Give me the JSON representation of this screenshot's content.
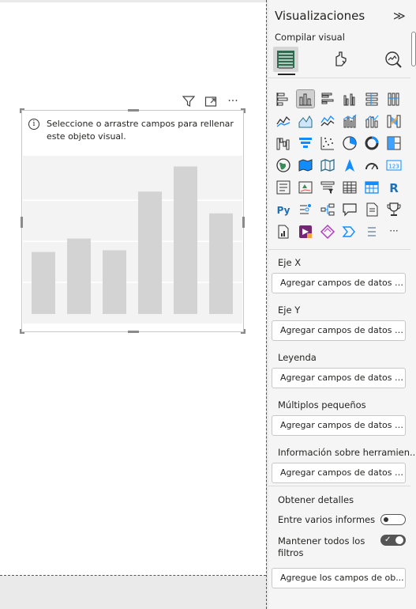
{
  "visual": {
    "message": "Seleccione o arrastre campos para rellenar este objeto visual.",
    "header_icons": [
      "filter-icon",
      "focus-mode-icon",
      "more-options-icon"
    ],
    "more_glyph": "···",
    "placeholder_bars": [
      0.37,
      0.45,
      0.38,
      0.73,
      0.88,
      0.6
    ]
  },
  "pane": {
    "title": "Visualizaciones",
    "collapse_glyph": "≫",
    "subtitle": "Compilar visual",
    "tabs": [
      "build-visual-icon",
      "format-visual-icon",
      "analytics-icon"
    ],
    "visual_types": [
      "stacked-bar-chart-icon",
      "stacked-column-chart-icon",
      "clustered-bar-chart-icon",
      "clustered-column-chart-icon",
      "100-stacked-bar-chart-icon",
      "100-stacked-column-chart-icon",
      "line-chart-icon",
      "area-chart-icon",
      "stacked-area-chart-icon",
      "line-clustered-column-icon",
      "line-stacked-column-icon",
      "ribbon-chart-icon",
      "waterfall-chart-icon",
      "funnel-icon",
      "scatter-chart-icon",
      "pie-chart-icon",
      "donut-chart-icon",
      "treemap-icon",
      "map-icon",
      "filled-map-icon",
      "shape-map-icon",
      "azure-map-icon",
      "gauge-icon",
      "card-icon",
      "multi-row-card-icon",
      "kpi-icon",
      "slicer-icon",
      "table-icon",
      "matrix-icon",
      "r-visual-icon",
      "python-visual-icon",
      "key-influencers-icon",
      "decomposition-tree-icon",
      "qa-icon",
      "smart-narrative-icon",
      "goals-icon",
      "paginated-report-icon",
      "power-apps-icon",
      "power-automate-icon",
      "get-more-visuals-icon",
      "sparkle-icon",
      "more-visuals-icon"
    ],
    "r_label": "R",
    "py_label": "Py",
    "card_label": "123",
    "more_label": "···",
    "wells": [
      {
        "label": "Eje X",
        "placeholder": "Agregar campos de datos a..."
      },
      {
        "label": "Eje Y",
        "placeholder": "Agregar campos de datos a..."
      },
      {
        "label": "Leyenda",
        "placeholder": "Agregar campos de datos a..."
      },
      {
        "label": "Múltiplos pequeños",
        "placeholder": "Agregar campos de datos a..."
      },
      {
        "label": "Información sobre herramien...",
        "placeholder": "Agregar campos de datos a..."
      }
    ],
    "drillthrough": {
      "title": "Obtener detalles",
      "cross_report": {
        "label": "Entre varios informes",
        "on": false
      },
      "keep_filters": {
        "label": "Mantener todos los filtros",
        "on": true
      },
      "placeholder": "Agregue los campos de ob..."
    },
    "colors": {
      "pane_bg": "#f5f5f5",
      "placeholder_bar": "#d3d3d3",
      "selected_bg": "#d0d0d0",
      "icon_accent": "#118dff"
    }
  }
}
